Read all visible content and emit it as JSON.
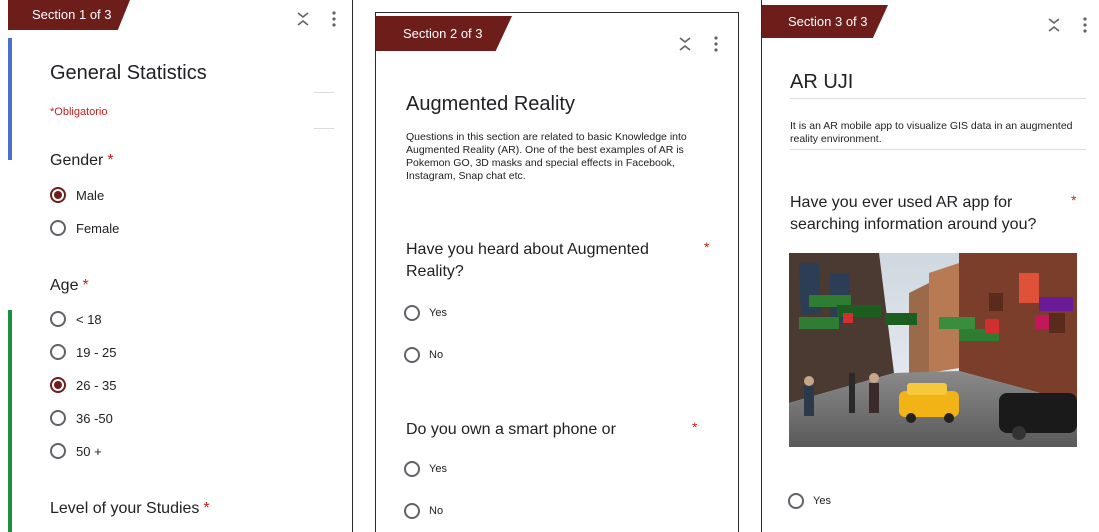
{
  "panel1": {
    "section": "Section 1 of 3",
    "title": "General Statistics",
    "required_note": "*Obligatorio",
    "gender": {
      "label": "Gender",
      "options": [
        {
          "label": "Male",
          "checked": true
        },
        {
          "label": "Female",
          "checked": false
        }
      ]
    },
    "age": {
      "label": "Age",
      "options": [
        {
          "label": "< 18",
          "checked": false
        },
        {
          "label": "19 - 25",
          "checked": false
        },
        {
          "label": "26 - 35",
          "checked": true
        },
        {
          "label": "36 -50",
          "checked": false
        },
        {
          "label": "50 +",
          "checked": false
        }
      ]
    },
    "studies": {
      "label": "Level of your Studies"
    }
  },
  "panel2": {
    "section": "Section 2 of 3",
    "title": "Augmented Reality",
    "description": "Questions in this section are related to basic Knowledge into Augmented Reality (AR). One of the best examples of AR is Pokemon GO, 3D masks and special effects in Facebook, Instagram, Snap chat etc.",
    "q1": {
      "label": "Have you heard about Augmented Reality?",
      "options": [
        {
          "label": "Yes",
          "checked": false
        },
        {
          "label": "No",
          "checked": false
        }
      ]
    },
    "q2": {
      "label": "Do you own a smart phone or",
      "options": [
        {
          "label": "Yes",
          "checked": false
        },
        {
          "label": "No",
          "checked": false
        }
      ]
    }
  },
  "panel3": {
    "section": "Section 3 of 3",
    "title": "AR UJI",
    "description": "It is an AR mobile app to visualize GIS data in an augmented reality environment.",
    "q1": {
      "label": "Have you ever used AR app for searching information around you?",
      "options": [
        {
          "label": "Yes",
          "checked": false
        }
      ]
    }
  },
  "colors": {
    "section_tab": "#6d1d1a",
    "required": "#c5221f",
    "radio_checked": "#6d1d1a",
    "accent_blue": "#4a6fcf",
    "accent_green": "#1e8e3e"
  },
  "icons": [
    "collapse-icon",
    "more-vert-icon",
    "radio-icon"
  ],
  "required_mark": "*"
}
